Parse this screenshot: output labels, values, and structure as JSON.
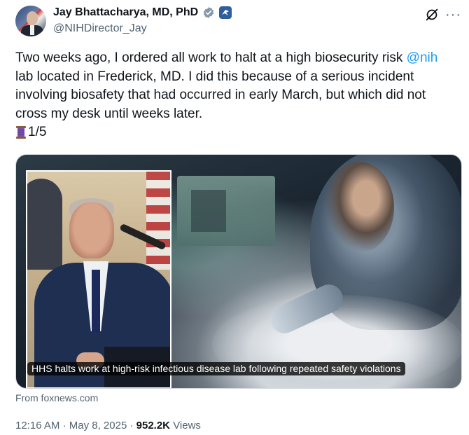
{
  "author": {
    "display_name": "Jay Bhattacharya, MD, PhD",
    "handle": "@NIHDirector_Jay"
  },
  "icons": {
    "verified": "verified-badge-icon",
    "government": "government-affiliation-icon",
    "grok": "grok-icon",
    "more": "more-options-icon",
    "thread": "thread-spool-emoji"
  },
  "tweet": {
    "text_before": "Two weeks ago, I ordered all work to halt at a high biosecurity risk ",
    "mention": "@nih",
    "text_after": " lab located in Frederick, MD. I did this because of a serious incident involving biosafety that had occurred in early March, but which did not cross my desk until weeks later.",
    "thread_count": "1/5"
  },
  "card": {
    "caption": "HHS halts work at high-risk infectious disease lab following repeated safety violations",
    "source": "From foxnews.com"
  },
  "meta": {
    "time": "12:16 AM",
    "date": "May 8, 2025",
    "separator": "·",
    "views_count": "952.2K",
    "views_label": "Views"
  },
  "colors": {
    "link": "#1d9bf0",
    "verified": "#829aab",
    "text": "#0f1419",
    "muted": "#536471"
  }
}
